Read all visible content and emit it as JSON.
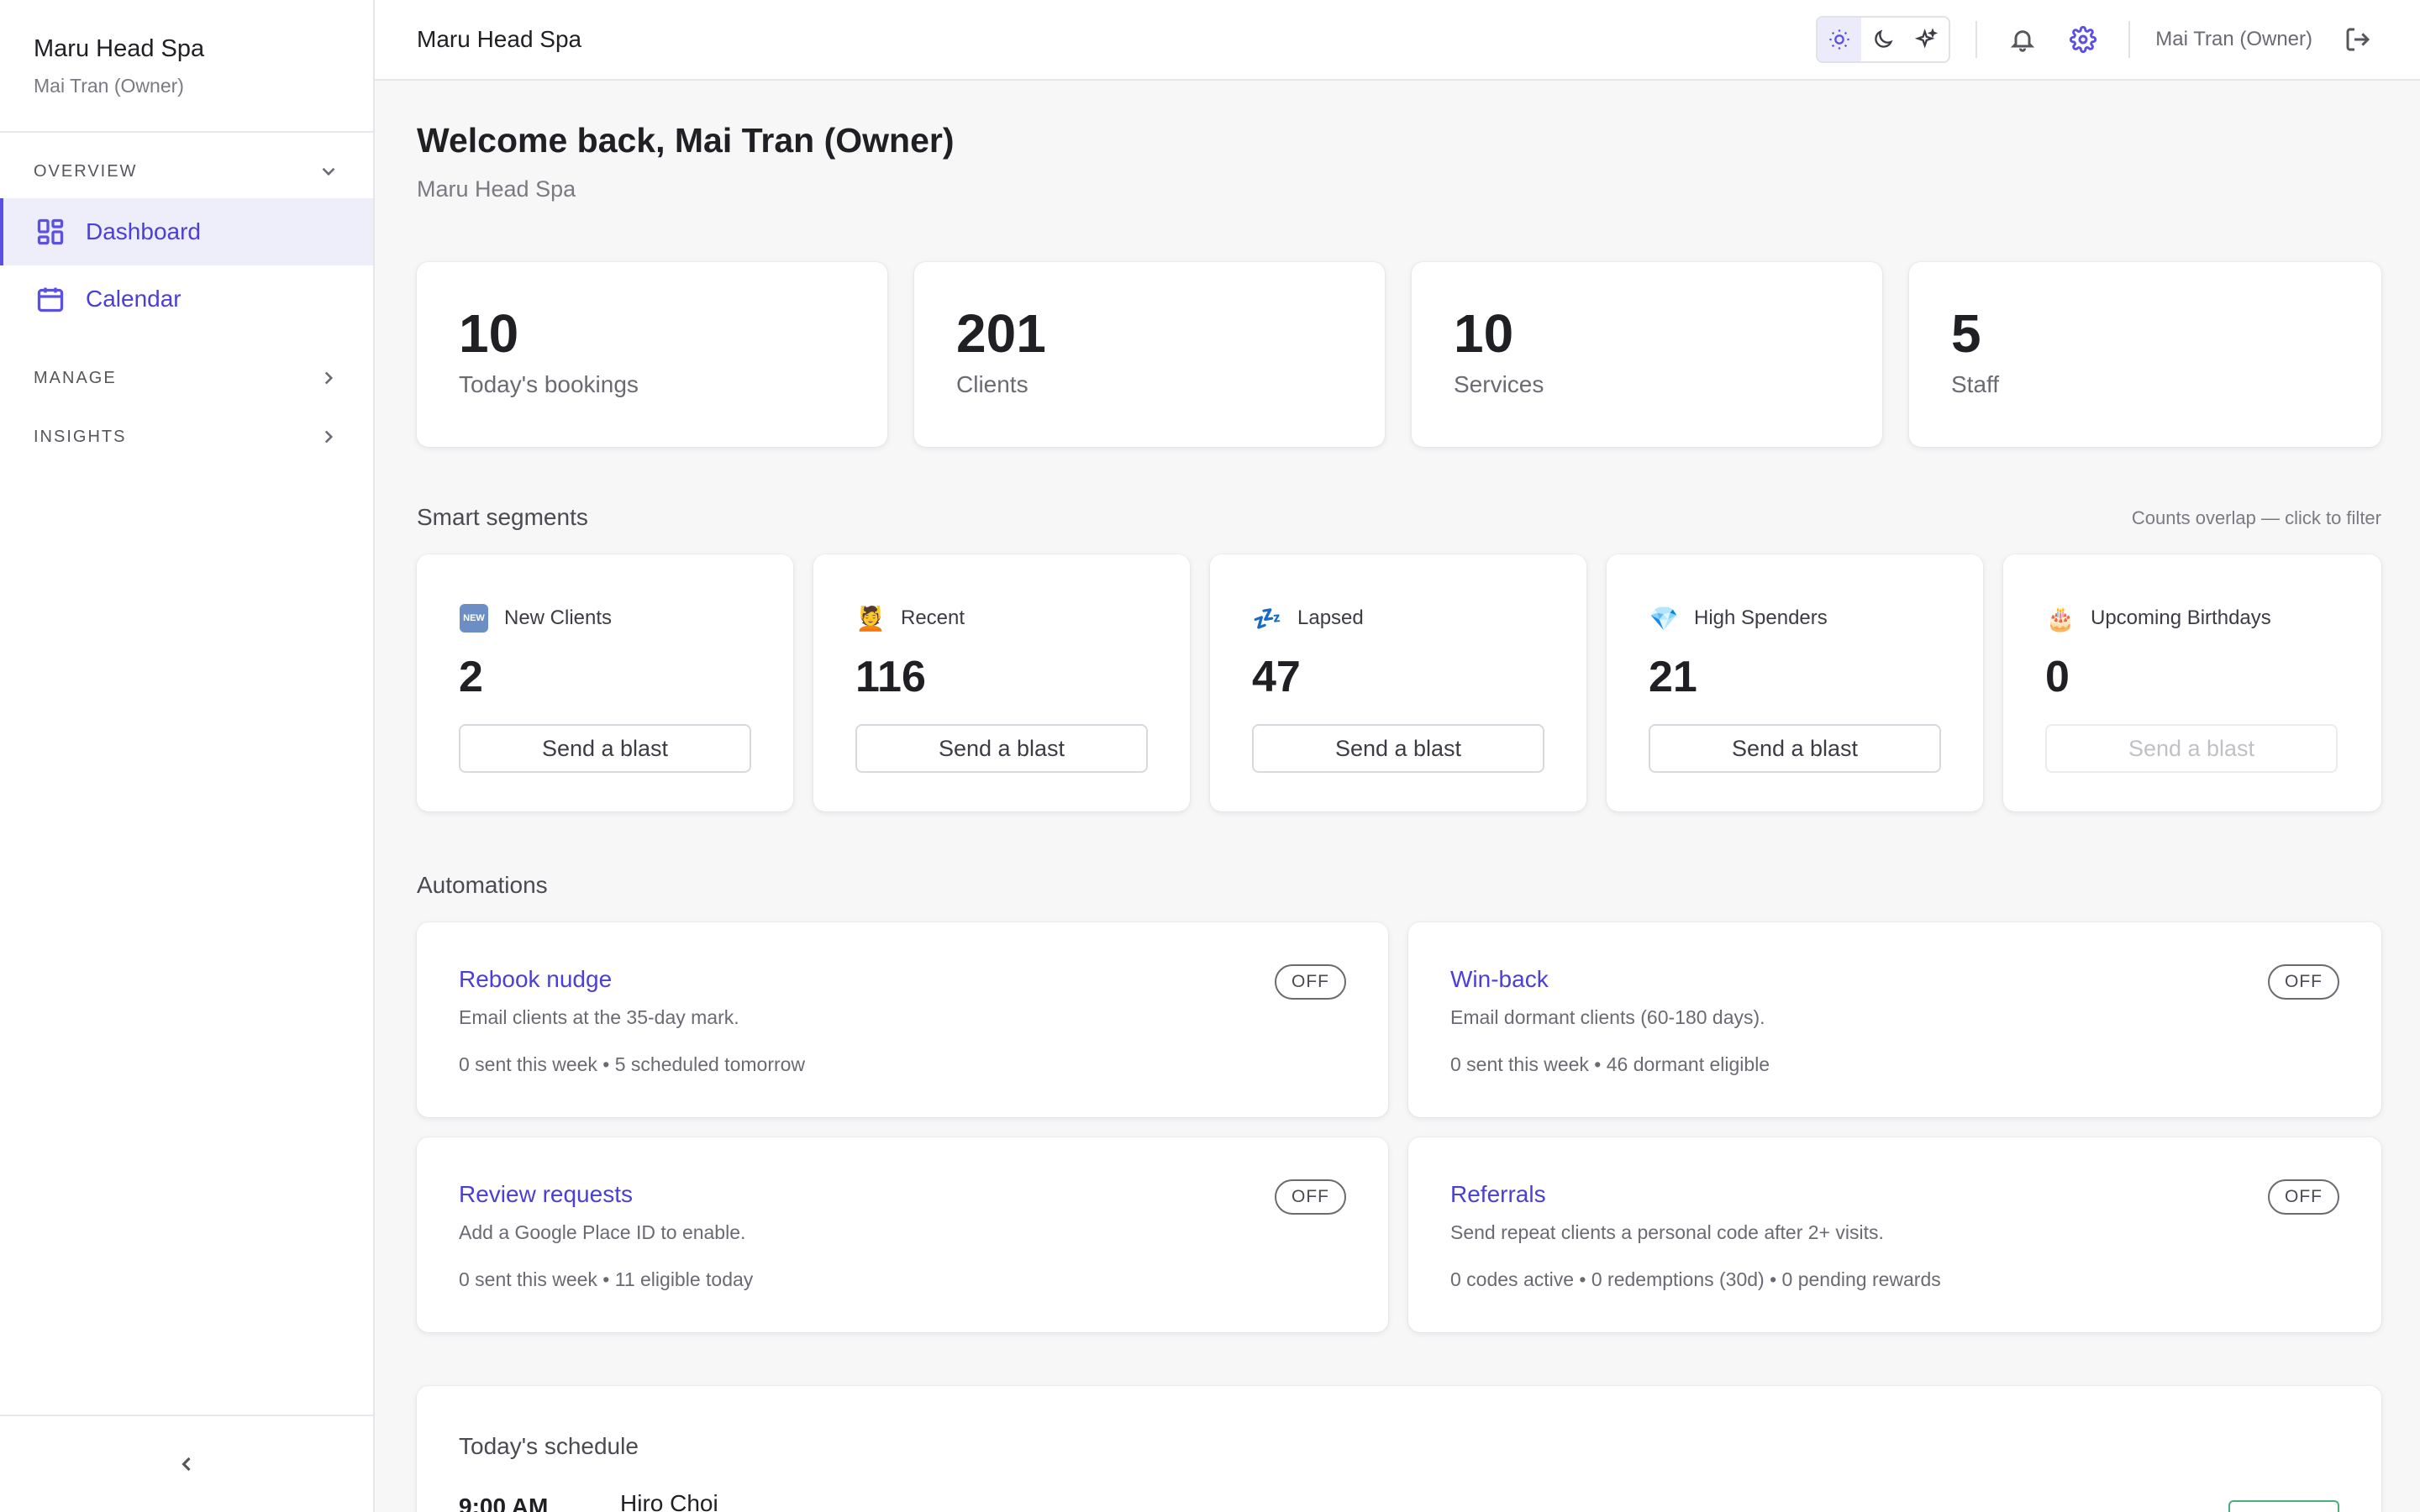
{
  "sidebar": {
    "brand_title": "Maru Head Spa",
    "brand_sub": "Mai Tran (Owner)",
    "sections": {
      "overview": "OVERVIEW",
      "manage": "MANAGE",
      "insights": "INSIGHTS"
    },
    "items": [
      {
        "label": "Dashboard",
        "icon": "dashboard-grid-icon",
        "active": true
      },
      {
        "label": "Calendar",
        "icon": "calendar-icon",
        "active": false
      }
    ]
  },
  "topbar": {
    "title": "Maru Head Spa",
    "theme_options": [
      "light-sun-icon",
      "dark-moon-icon",
      "sparkle-theme-icon"
    ],
    "user": "Mai Tran (Owner)"
  },
  "welcome": {
    "title": "Welcome back, Mai Tran (Owner)",
    "subtitle": "Maru Head Spa"
  },
  "stats": [
    {
      "value": "10",
      "label": "Today's bookings"
    },
    {
      "value": "201",
      "label": "Clients"
    },
    {
      "value": "10",
      "label": "Services"
    },
    {
      "value": "5",
      "label": "Staff"
    }
  ],
  "segments": {
    "title": "Smart segments",
    "note": "Counts overlap — click to filter",
    "button_label": "Send a blast",
    "items": [
      {
        "icon": "new-badge-icon",
        "icon_glyph": "NEW",
        "label": "New Clients",
        "value": "2",
        "disabled": false
      },
      {
        "icon": "person-massage-icon",
        "icon_glyph": "💆",
        "label": "Recent",
        "value": "116",
        "disabled": false
      },
      {
        "icon": "sleeping-zzz-icon",
        "icon_glyph": "💤",
        "label": "Lapsed",
        "value": "47",
        "disabled": false
      },
      {
        "icon": "gem-icon",
        "icon_glyph": "💎",
        "label": "High Spenders",
        "value": "21",
        "disabled": false
      },
      {
        "icon": "birthday-cake-icon",
        "icon_glyph": "🎂",
        "label": "Upcoming Birthdays",
        "value": "0",
        "disabled": true
      }
    ]
  },
  "automations": {
    "title": "Automations",
    "items": [
      {
        "title": "Rebook nudge",
        "desc": "Email clients at the 35-day mark.",
        "meta": "0 sent this week • 5 scheduled tomorrow",
        "state": "OFF"
      },
      {
        "title": "Win-back",
        "desc": "Email dormant clients (60-180 days).",
        "meta": "0 sent this week • 46 dormant eligible",
        "state": "OFF"
      },
      {
        "title": "Review requests",
        "desc": "Add a Google Place ID to enable.",
        "meta": "0 sent this week • 11 eligible today",
        "state": "OFF"
      },
      {
        "title": "Referrals",
        "desc": "Send repeat clients a personal code after 2+ visits.",
        "meta": "0 codes active • 0 redemptions (30d) • 0 pending rewards",
        "state": "OFF"
      }
    ]
  },
  "schedule": {
    "title": "Today's schedule",
    "first_time": "9:00 AM",
    "first_client": "Hiro Choi"
  },
  "colors": {
    "accent": "#5b50e4",
    "accent_text": "#4a3fd6",
    "status_green": "#4caf7a"
  }
}
